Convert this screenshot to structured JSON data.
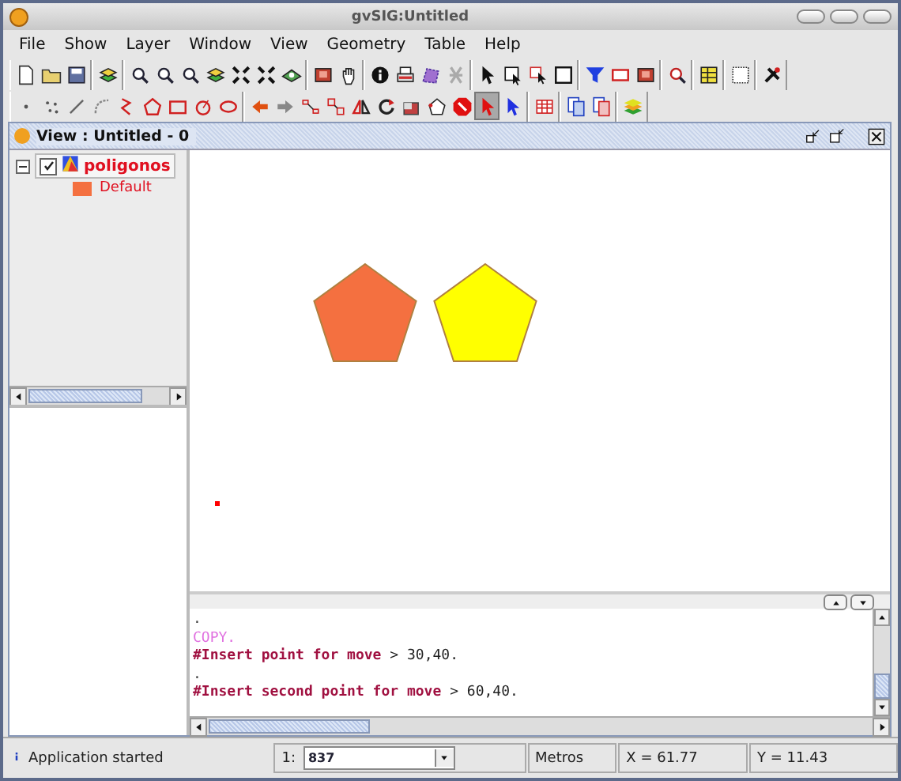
{
  "window": {
    "title": "gvSIG:Untitled"
  },
  "menu": [
    "File",
    "Show",
    "Layer",
    "Window",
    "View",
    "Geometry",
    "Table",
    "Help"
  ],
  "toolbars": [
    [
      [
        {
          "selected": false
        },
        {
          "selected": false
        },
        {
          "selected": false
        }
      ],
      [
        {
          "selected": false
        }
      ],
      [
        {
          "selected": false
        },
        {
          "selected": false
        },
        {
          "selected": false
        },
        {
          "selected": false
        },
        {
          "selected": false
        },
        {
          "selected": false
        },
        {
          "selected": false
        }
      ],
      [
        {
          "selected": false
        },
        {
          "selected": false
        }
      ],
      [
        {
          "selected": false
        },
        {
          "selected": false
        },
        {
          "selected": false
        },
        {
          "selected": false
        }
      ],
      [
        {
          "selected": false
        },
        {
          "selected": false
        },
        {
          "selected": false
        },
        {
          "selected": false
        }
      ],
      [
        {
          "selected": false
        },
        {
          "selected": false
        },
        {
          "selected": false
        }
      ],
      [
        {
          "selected": false
        }
      ],
      [
        {
          "selected": false
        }
      ],
      [
        {
          "selected": false
        }
      ],
      [
        {
          "selected": false
        }
      ]
    ],
    [
      [
        {
          "selected": false
        },
        {
          "selected": false
        },
        {
          "selected": false
        },
        {
          "selected": false
        },
        {
          "selected": false
        },
        {
          "selected": false
        },
        {
          "selected": false
        },
        {
          "selected": false
        },
        {
          "selected": false
        }
      ],
      [
        {
          "selected": false
        },
        {
          "selected": false
        },
        {
          "selected": false
        },
        {
          "selected": false
        },
        {
          "selected": false
        },
        {
          "selected": false
        },
        {
          "selected": false
        },
        {
          "selected": false
        },
        {
          "selected": false
        },
        {
          "selected": true
        },
        {
          "selected": false
        }
      ],
      [
        {
          "selected": false
        }
      ],
      [
        {
          "selected": false
        },
        {
          "selected": false
        }
      ],
      [
        {
          "selected": false
        }
      ]
    ]
  ],
  "view": {
    "title": "View : Untitled - 0"
  },
  "layers": [
    {
      "name": "poligonos",
      "checked": true,
      "expanded": true,
      "children": [
        {
          "name": "Default",
          "color": "#f47040"
        }
      ]
    }
  ],
  "map": {
    "features": [
      {
        "kind": "pentagon",
        "color": "#f47040"
      },
      {
        "kind": "pentagon",
        "color": "#ffff00"
      },
      {
        "kind": "point",
        "color": "#ff0000"
      }
    ]
  },
  "console": {
    "lines": [
      {
        "kind": "plain",
        "text": "."
      },
      {
        "kind": "command",
        "text": "COPY."
      },
      {
        "kind": "prompt",
        "text": "#Insert point for move",
        "reply": "> 30,40."
      },
      {
        "kind": "plain",
        "text": "."
      },
      {
        "kind": "prompt",
        "text": "#Insert second point for move",
        "reply": "> 60,40."
      }
    ]
  },
  "status": {
    "message": "Application started",
    "scale_prefix": "1:",
    "scale": "837",
    "units": "Metros",
    "x": "X = 61.77",
    "y": "Y = 11.43"
  }
}
